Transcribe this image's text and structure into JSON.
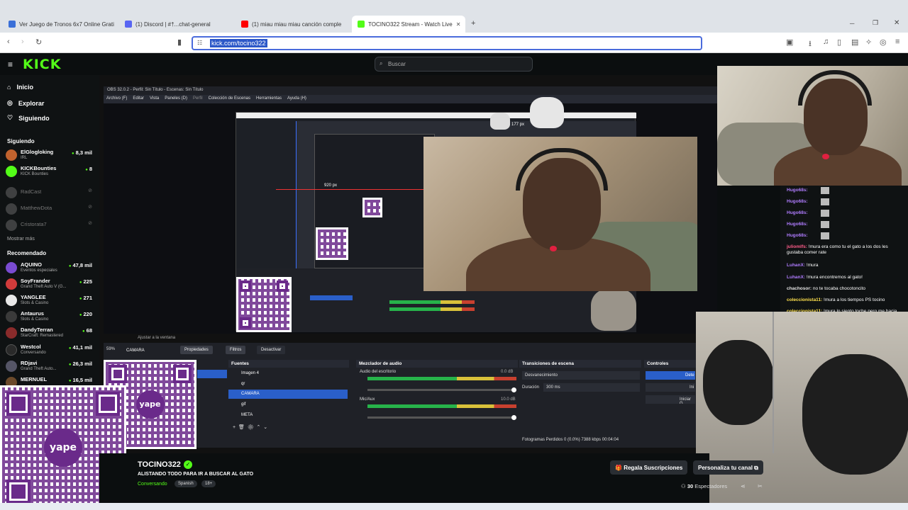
{
  "browser": {
    "tabs": [
      {
        "label": "Ver Juego de Tronos 6x7 Online Grati",
        "color": "#3a6fd8"
      },
      {
        "label": "(1) Discord | #†...chat-general",
        "color": "#5865f2"
      },
      {
        "label": "(1) miau miau miau canción comple",
        "color": "#ff0000"
      },
      {
        "label": "TOCINO322 Stream - Watch Live",
        "color": "#53fc18"
      }
    ],
    "new_tab": "+",
    "url": "kick.com/tocino322"
  },
  "kick": {
    "logo": "KICK",
    "search_placeholder": "Buscar",
    "nav": [
      {
        "label": "Inicio"
      },
      {
        "label": "Explorar"
      },
      {
        "label": "Siguiendo"
      }
    ],
    "following_title": "Siguiendo",
    "following": [
      {
        "name": "ElGlogloking",
        "category": "IRL",
        "viewers": "8,3 mil",
        "color": "#c0622e",
        "live": true
      },
      {
        "name": "KICKBounties",
        "category": "KICK Bounties",
        "viewers": "8",
        "color": "#53fc18",
        "live": true
      },
      {
        "name": "RadCast",
        "category": "",
        "viewers": "",
        "color": "#888",
        "live": false
      },
      {
        "name": "MatthewDota",
        "category": "",
        "viewers": "",
        "color": "#888",
        "live": false
      },
      {
        "name": "Cristorata7",
        "category": "",
        "viewers": "",
        "color": "#888",
        "live": false
      }
    ],
    "show_more": "Mostrar más",
    "recommended_title": "Recomendado",
    "recommended": [
      {
        "name": "AQUINO",
        "category": "Eventos especiales",
        "viewers": "47,8 mil",
        "color": "#7a4bd1"
      },
      {
        "name": "SoyFrander",
        "category": "Grand Theft Auto V (G...",
        "viewers": "225",
        "color": "#d13b3b"
      },
      {
        "name": "YANGLEE",
        "category": "Slots & Casino",
        "viewers": "271",
        "color": "#e8e8e8"
      },
      {
        "name": "Antaurus",
        "category": "Slots & Casino",
        "viewers": "220",
        "color": "#3a3a3a"
      },
      {
        "name": "DandyTerran",
        "category": "StarCraft: Remastered",
        "viewers": "68",
        "color": "#8a2b2b"
      },
      {
        "name": "Westcol",
        "category": "Conversando",
        "viewers": "41,1 mil",
        "color": "#2a2a2a"
      },
      {
        "name": "RDjavi",
        "category": "Grand Theft Auto...",
        "viewers": "26,3 mil",
        "color": "#556"
      },
      {
        "name": "MERNUEL",
        "category": "",
        "viewers": "16,5 mil",
        "color": "#6b4a2b"
      }
    ]
  },
  "obs": {
    "title": "OBS 32.0.2 - Perfil: Sin Título - Escenas: Sin Título",
    "menu": [
      "Archivo (F)",
      "Editar",
      "Vista",
      "Paneles (D)",
      "Perfil",
      "Colección de Escenas",
      "Herramientas",
      "Ayuda (H)"
    ],
    "measure_1": "177 px",
    "measure_2": "920 px",
    "source_bar_label": "CAMARA",
    "props_button": "Propiedades",
    "filters_button": "Filtros",
    "deactivate_button": "Desactivar",
    "docks": {
      "sources": "Fuentes",
      "mixer": "Mezclador de audio",
      "transitions": "Transiciones de escena",
      "controls": "Controles"
    },
    "sources": [
      {
        "label": "Imagen 4",
        "selected": false
      },
      {
        "label": "qr",
        "selected": false
      },
      {
        "label": "CAMARA",
        "selected": true
      },
      {
        "label": "gif",
        "selected": false
      },
      {
        "label": "META",
        "selected": false
      }
    ],
    "mixer": [
      {
        "label": "Audio del escritorio",
        "db": "0.0 dB"
      },
      {
        "label": "Mic/Aux",
        "db": "10.0 dB"
      }
    ],
    "transition": "Desvanecimiento",
    "duration_label": "Duración",
    "duration_value": "300 ms",
    "controls_buttons": [
      "Dete",
      "Ini",
      "Iniciar G"
    ],
    "status": "Fotogramas Perdidos 0 (0.0%)   7388 kbps   00:04:04",
    "zoom_label": "59%",
    "fit_label": "Ajustar a la ventana"
  },
  "qr_label": "yape",
  "chat": [
    {
      "user": "Hugo68s:",
      "text": "",
      "color": "#b07cff"
    },
    {
      "user": "Hugo68s:",
      "text": "",
      "color": "#b07cff"
    },
    {
      "user": "Hugo68s:",
      "text": "",
      "color": "#b07cff"
    },
    {
      "user": "Hugo68s:",
      "text": "",
      "color": "#b07cff"
    },
    {
      "user": "Hugo68s:",
      "text": "",
      "color": "#b07cff"
    },
    {
      "user": "juliomlfs:",
      "text": "!mura era como tu el gato a los dos les gustaba comer rate",
      "color": "#ff5c8a"
    },
    {
      "user": "LuhanX:",
      "text": "!mura",
      "color": "#b07cff"
    },
    {
      "user": "LuhanX:",
      "text": "!mura encontremos al gato!",
      "color": "#b07cff"
    },
    {
      "user": "chachosor:",
      "text": "no te tocaba chocotoncito",
      "color": "#e6e6e6"
    },
    {
      "user": "coleccionista11:",
      "text": "!mura a los tiempos PS tocino",
      "color": "#ffe14d"
    },
    {
      "user": "coleccionista11:",
      "text": "!mura lo siento toche pero me hacia falta un gato para el estofado mas tarde lo llevo la",
      "color": "#ffe14d"
    }
  ],
  "stream": {
    "streamer": "TOCINO322",
    "verified_icon": "✓",
    "title": "ALISTANDO TODO PARA IR A BUSCAR AL GATO",
    "category": "Conversando",
    "tags": [
      "Spanish",
      "18+"
    ],
    "gift_button": "Regala Suscripciones",
    "customize_button": "Personaliza tu canal",
    "viewers_count": "30",
    "viewers_label": "Espectadores"
  },
  "colors": {
    "kick_green": "#53fc18",
    "obs_select": "#2a5fc9",
    "url_highlight": "#2c58c8"
  }
}
